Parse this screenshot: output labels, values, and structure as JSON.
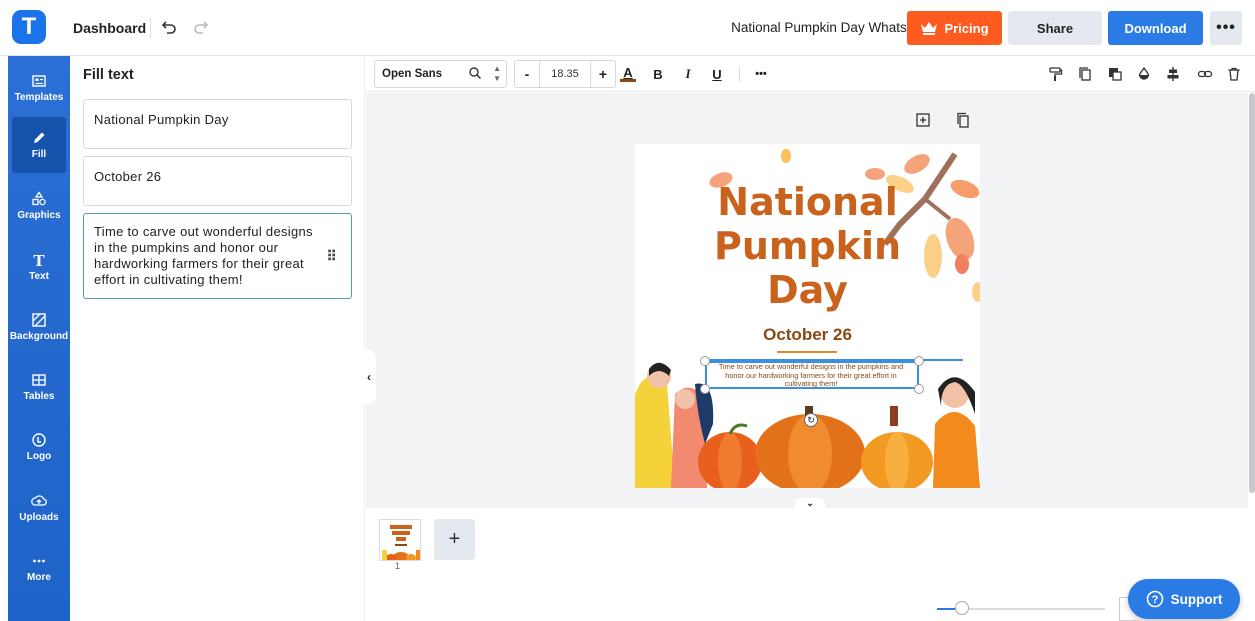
{
  "header": {
    "logo_letter": "T",
    "dashboard_label": "Dashboard",
    "doc_title": "National Pumpkin Day Whatsapp Post",
    "pricing_label": "Pricing",
    "share_label": "Share",
    "download_label": "Download",
    "more_label": "•••"
  },
  "sidebar": {
    "items": [
      {
        "label": "Templates",
        "icon": "templates-icon"
      },
      {
        "label": "Fill",
        "icon": "pencil-icon"
      },
      {
        "label": "Graphics",
        "icon": "shapes-icon"
      },
      {
        "label": "Text",
        "icon": "text-icon"
      },
      {
        "label": "Background",
        "icon": "background-icon"
      },
      {
        "label": "Tables",
        "icon": "table-icon"
      },
      {
        "label": "Logo",
        "icon": "logo-icon"
      },
      {
        "label": "Uploads",
        "icon": "upload-icon"
      },
      {
        "label": "More",
        "icon": "more-icon"
      }
    ]
  },
  "fill_panel": {
    "title": "Fill text",
    "fields": [
      "National Pumpkin Day",
      "October 26",
      "Time to carve out wonderful designs in the pumpkins and honor our hardworking farmers for their great effort in cultivating them!"
    ]
  },
  "toolbar": {
    "font": "Open Sans",
    "size_minus": "-",
    "size_value": "18.35",
    "size_plus": "+",
    "color_letter": "A",
    "bold": "B",
    "italic": "I",
    "underline": "U",
    "more": "•••"
  },
  "artboard": {
    "title": "National Pumpkin Day",
    "date": "October 26",
    "body": "Time to carve out wonderful designs in the pumpkins and honor our hardworking farmers for their great effort in cultivating them!"
  },
  "pages": {
    "page_number": "1",
    "add_label": "+"
  },
  "support_label": "Support",
  "colors": {
    "brand": "#2a7be4",
    "pricing": "#ff5a1f",
    "title_orange": "#c9621c"
  }
}
